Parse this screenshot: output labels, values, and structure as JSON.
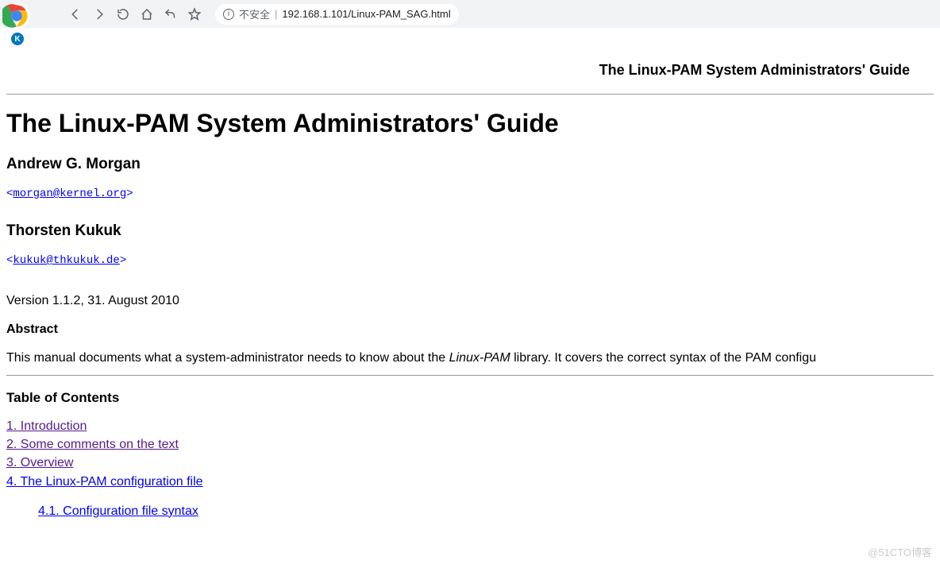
{
  "browser": {
    "insecure_label": "不安全",
    "url_sep": "|",
    "url": "192.168.1.101/Linux-PAM_SAG.html",
    "bookmark_letter": "K"
  },
  "page": {
    "header_right": "The Linux-PAM System Administrators' Guide",
    "title": "The Linux-PAM System Administrators' Guide",
    "author1": "Andrew G. Morgan",
    "email1_open": "<",
    "email1": "morgan@kernel.org",
    "email1_close": ">",
    "author2": "Thorsten Kukuk",
    "email2_open": "<",
    "email2": "kukuk@thkukuk.de",
    "email2_close": ">",
    "version": "Version 1.1.2, 31. August 2010",
    "abstract_label": "Abstract",
    "abstract_text_pre": "This manual documents what a system-administrator needs to know about the ",
    "abstract_em": "Linux-PAM",
    "abstract_text_post": " library. It covers the correct syntax of the PAM configu",
    "toc_heading": "Table of Contents",
    "toc": [
      {
        "label": "1. Introduction",
        "visited": true
      },
      {
        "label": "2. Some comments on the text",
        "visited": true
      },
      {
        "label": "3. Overview",
        "visited": true
      },
      {
        "label": "4. The Linux-PAM configuration file",
        "visited": false
      }
    ],
    "toc_sub1": "4.1. Configuration file syntax"
  },
  "watermark": "@51CTO博客"
}
